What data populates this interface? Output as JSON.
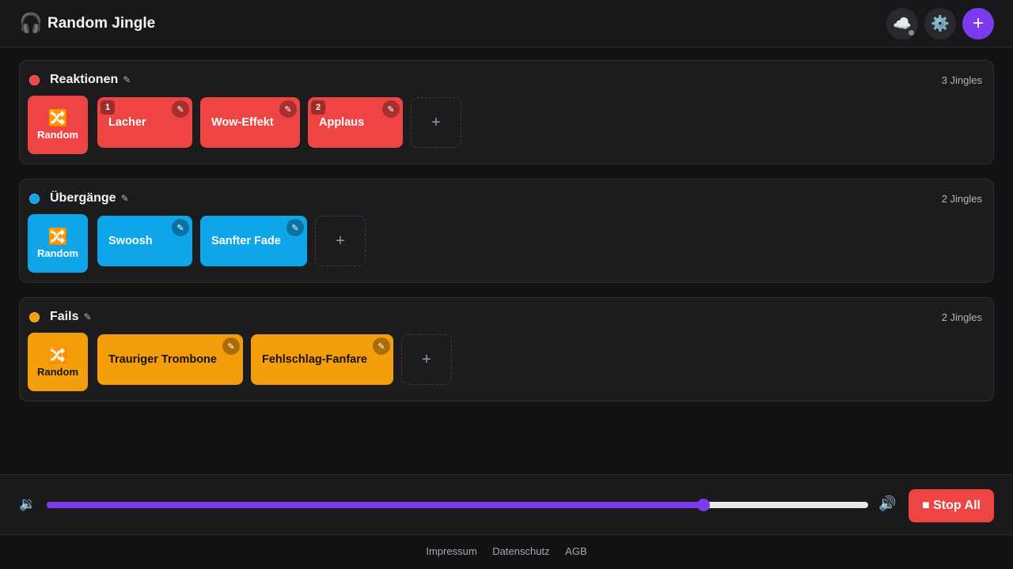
{
  "header": {
    "title": "Random Jingle",
    "icons": {
      "brand": "headphones-icon",
      "cloud": "cloud-icon",
      "settings": "gear-icon",
      "add": "plus-icon"
    },
    "add_label": "+"
  },
  "categories": [
    {
      "name": "Reaktionen",
      "count_label": "3 Jingles",
      "color": "#ef4444",
      "random_label": "Random",
      "jingles": [
        {
          "label": "Lacher",
          "badge": "1"
        },
        {
          "label": "Wow-Effekt",
          "badge": ""
        },
        {
          "label": "Applaus",
          "badge": "2"
        }
      ]
    },
    {
      "name": "Übergänge",
      "count_label": "2 Jingles",
      "color": "#0ea5e9",
      "random_label": "Random",
      "jingles": [
        {
          "label": "Swoosh",
          "badge": ""
        },
        {
          "label": "Sanfter Fade",
          "badge": ""
        }
      ]
    },
    {
      "name": "Fails",
      "count_label": "2 Jingles",
      "color": "#f59e0b",
      "random_label": "Random",
      "jingles": [
        {
          "label": "Trauriger Trombone",
          "badge": ""
        },
        {
          "label": "Fehlschlag-Fanfare",
          "badge": ""
        }
      ]
    }
  ],
  "add_tile_label": "+",
  "player": {
    "volume_percent": 80,
    "stop_label": "■ Stop All",
    "icons": {
      "low": "volume-low-icon",
      "high": "volume-high-icon"
    }
  },
  "footer": {
    "links": [
      "Impressum",
      "Datenschutz",
      "AGB"
    ]
  },
  "colors": {
    "accent": "#7c3aed",
    "stop": "#ef4444"
  }
}
